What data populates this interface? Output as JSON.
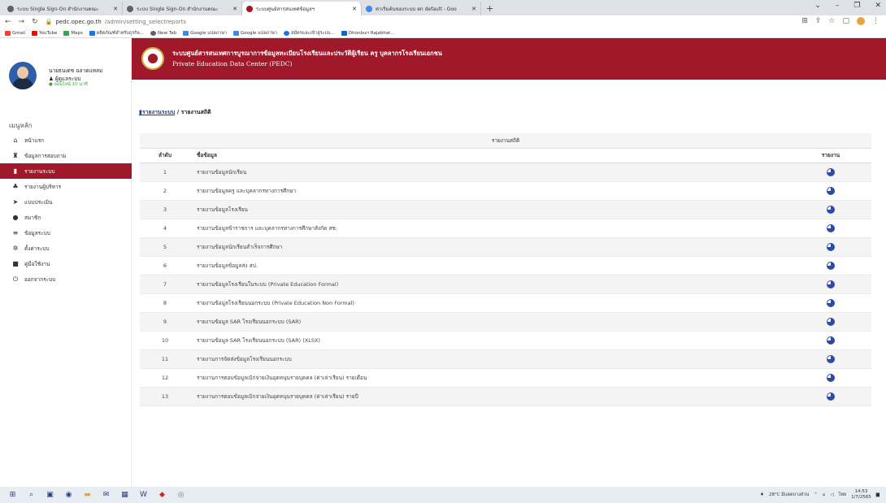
{
  "browser": {
    "tabs": [
      {
        "title": "ระบบ Single Sign-On สำนักงานคณะ",
        "icon": "sso-icon",
        "active": false
      },
      {
        "title": "ระบบ Single Sign-On สำนักงานคณะ",
        "icon": "sso-icon",
        "active": false
      },
      {
        "title": "ระบบศูนย์สารสนเทศข้อมูลฯ",
        "icon": "pedc-icon",
        "active": true
      },
      {
        "title": "ค่าเริ่มต้นของระบบ en default - Goo",
        "icon": "google-icon",
        "active": false
      }
    ],
    "new_tab": "+",
    "url_host": "pedc.opec.go.th",
    "url_path": "/admin/setting_selectreports",
    "bookmarks": [
      "Gmail",
      "YouTube",
      "Maps",
      "ผลิตภัณฑ์สำหรับธุรกิจ...",
      "New Tab",
      "Google แปลภาษา",
      "Google แปลภาษา",
      "สมัครและเข้าสู่ระบบ...",
      "Dhonburi Rajabhat..."
    ]
  },
  "user": {
    "name": "นายธนเดช ฉลาดแหลม",
    "role": "ผู้ดูแลระบบ",
    "status": "ออนไลน์ 10 นาที"
  },
  "menu_heading": "เมนูหลัก",
  "menu": [
    {
      "label": "หน้าแรก",
      "icon": "home-icon",
      "glyph": "⌂",
      "active": false
    },
    {
      "label": "ข้อมูลการสอบถาม",
      "icon": "sitemap-icon",
      "glyph": "♜",
      "active": false
    },
    {
      "label": "รายงานระบบ",
      "icon": "bar-chart-icon",
      "glyph": "▮",
      "active": true
    },
    {
      "label": "รายงานผู้บริหาร",
      "icon": "users-icon",
      "glyph": "♣",
      "active": false
    },
    {
      "label": "แบบประเมิน",
      "icon": "send-icon",
      "glyph": "➤",
      "active": false
    },
    {
      "label": "สมาชิก",
      "icon": "user-icon",
      "glyph": "●",
      "active": false
    },
    {
      "label": "ข้อมูลระบบ",
      "icon": "list-icon",
      "glyph": "≡",
      "active": false
    },
    {
      "label": "ตั้งค่าระบบ",
      "icon": "gear-icon",
      "glyph": "✲",
      "active": false
    },
    {
      "label": "คู่มือใช้งาน",
      "icon": "book-icon",
      "glyph": "■",
      "active": false
    },
    {
      "label": "ออกจากระบบ",
      "icon": "power-icon",
      "glyph": "⏻",
      "active": false
    }
  ],
  "banner": {
    "title": "ระบบศูนย์สารสนเทศการบูรณาการข้อมูลทะเบียนโรงเรียนและประวัติผู้เรียน ครู บุคลากรโรงเรียนเอกชน",
    "subtitle": "Private Education Data Center (PEDC)"
  },
  "breadcrumb": {
    "section": "รายงานระบบ",
    "separator": " / ",
    "current": "รายงานสถิติ"
  },
  "table": {
    "caption": "รายงานสถิติ",
    "headers": {
      "no": "ลำดับ",
      "name": "ชื่อข้อมูล",
      "report": "รายงาน"
    },
    "rows": [
      {
        "no": "1",
        "name": "รายงานข้อมูลนักเรียน"
      },
      {
        "no": "2",
        "name": "รายงานข้อมูลครู และบุคลากรทางการศึกษา"
      },
      {
        "no": "3",
        "name": "รายงานข้อมูลโรงเรียน"
      },
      {
        "no": "4",
        "name": "รายงานข้อมูลข้าราชการ และบุคลากรทางการศึกษาสังกัด สช."
      },
      {
        "no": "5",
        "name": "รายงานข้อมูลนักเรียนสำเร็จการศึกษา"
      },
      {
        "no": "6",
        "name": "รายงานข้อมูลข้อมูลส่ง สป."
      },
      {
        "no": "7",
        "name": "รายงานข้อมูลโรงเรียนในระบบ (Private Education Formal)"
      },
      {
        "no": "8",
        "name": "รายงานข้อมูลโรงเรียนนอกระบบ (Private Education Non Formal)"
      },
      {
        "no": "9",
        "name": "รายงานข้อมูล SAR โรงเรียนนอกระบบ (SAR)"
      },
      {
        "no": "10",
        "name": "รายงานข้อมูล SAR โรงเรียนนอกระบบ (SAR) (XLSX)"
      },
      {
        "no": "11",
        "name": "รายงานการจัดส่งข้อมูลโรงเรียนนอกระบบ"
      },
      {
        "no": "12",
        "name": "รายงานการตอบข้อมูลเบิกจ่ายเงินอุดหนุนรายบุคคล (ค่าเล่าเรียน) รายเดือน"
      },
      {
        "no": "13",
        "name": "รายงานการตอบข้อมูลเบิกจ่ายเงินอุดหนุนรายบุคคล (ค่าเล่าเรียน) รายปี"
      }
    ]
  },
  "taskbar": {
    "weather": "28°C มีแดดบางส่วน",
    "lang": "ไทย",
    "time": "14:53",
    "date": "1/7/2565"
  },
  "colors": {
    "brand": "#a0192b",
    "report_icon": "#2f4aa3"
  }
}
